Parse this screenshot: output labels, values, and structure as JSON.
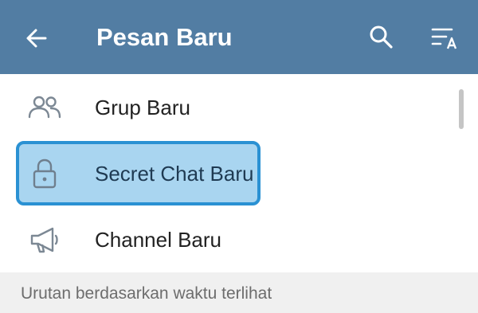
{
  "header": {
    "title": "Pesan Baru",
    "back_icon": "arrow-left-icon",
    "search_icon": "search-icon",
    "sort_icon": "sort-alphabetical-icon",
    "background_color": "#527da3"
  },
  "menu": {
    "items": [
      {
        "label": "Grup Baru",
        "icon": "people-icon"
      },
      {
        "label": "Secret Chat Baru",
        "icon": "lock-icon",
        "highlighted": true
      },
      {
        "label": "Channel Baru",
        "icon": "megaphone-icon"
      }
    ],
    "highlight_color": "#2a91d3"
  },
  "section": {
    "header_text": "Urutan berdasarkan waktu terlihat"
  }
}
